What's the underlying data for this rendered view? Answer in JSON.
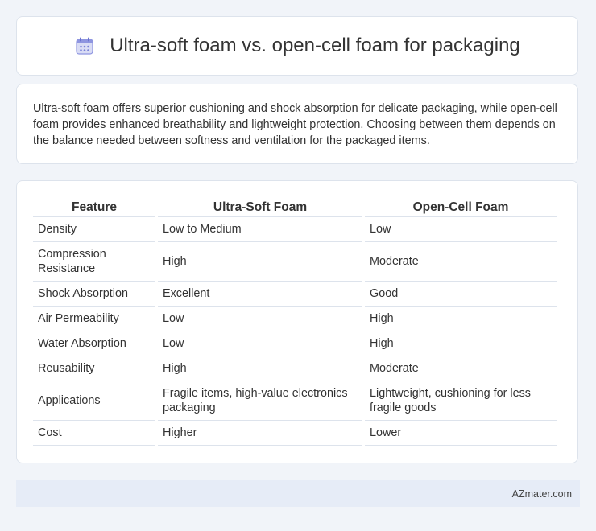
{
  "header": {
    "title": "Ultra-soft foam vs. open-cell foam for packaging",
    "icon": "calendar-icon"
  },
  "intro": {
    "text": "Ultra-soft foam offers superior cushioning and shock absorption for delicate packaging, while open-cell foam provides enhanced breathability and lightweight protection. Choosing between them depends on the balance needed between softness and ventilation for the packaged items."
  },
  "table": {
    "headers": [
      "Feature",
      "Ultra-Soft Foam",
      "Open-Cell Foam"
    ],
    "rows": [
      [
        "Density",
        "Low to Medium",
        "Low"
      ],
      [
        "Compression Resistance",
        "High",
        "Moderate"
      ],
      [
        "Shock Absorption",
        "Excellent",
        "Good"
      ],
      [
        "Air Permeability",
        "Low",
        "High"
      ],
      [
        "Water Absorption",
        "Low",
        "High"
      ],
      [
        "Reusability",
        "High",
        "Moderate"
      ],
      [
        "Applications",
        "Fragile items, high-value electronics packaging",
        "Lightweight, cushioning for less fragile goods"
      ],
      [
        "Cost",
        "Higher",
        "Lower"
      ]
    ]
  },
  "footer": {
    "brand": "AZmater.com"
  }
}
